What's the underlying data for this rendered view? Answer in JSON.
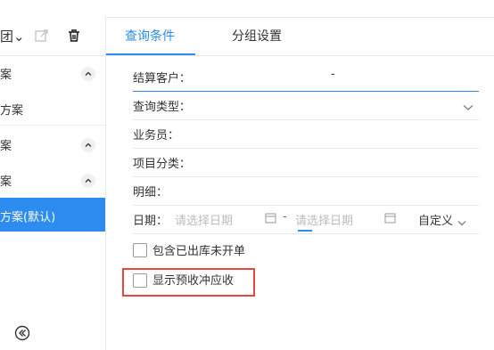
{
  "left": {
    "toolbar": {
      "partial_text": "团⌄",
      "icons": [
        "export-icon",
        "trash-icon"
      ]
    },
    "groups": [
      {
        "label": "案"
      },
      {
        "label": "方案"
      },
      {
        "label": "案"
      },
      {
        "label": "案"
      }
    ],
    "selected_item": "方案(默认)",
    "icons": {
      "collapse": "collapse-left-icon"
    }
  },
  "tabs": [
    {
      "label": "查询条件",
      "active": true
    },
    {
      "label": "分组设置",
      "active": false
    }
  ],
  "form": {
    "customer": {
      "label": "结算客户：",
      "value": "-"
    },
    "query_type": {
      "label": "查询类型："
    },
    "salesperson": {
      "label": "业务员："
    },
    "project_category": {
      "label": "项目分类："
    },
    "detail": {
      "label": "明细："
    },
    "date": {
      "label": "日期：",
      "start_placeholder": "请选择日期",
      "separator": "-",
      "end_placeholder": "请选择日期",
      "range_type": "自定义"
    }
  },
  "checkboxes": [
    {
      "label": "包含已出库未开单",
      "checked": false
    },
    {
      "label": "显示预收冲应收",
      "checked": false,
      "highlighted": true
    }
  ],
  "colors": {
    "accent": "#2d8cf0",
    "highlight": "#e5483f"
  }
}
